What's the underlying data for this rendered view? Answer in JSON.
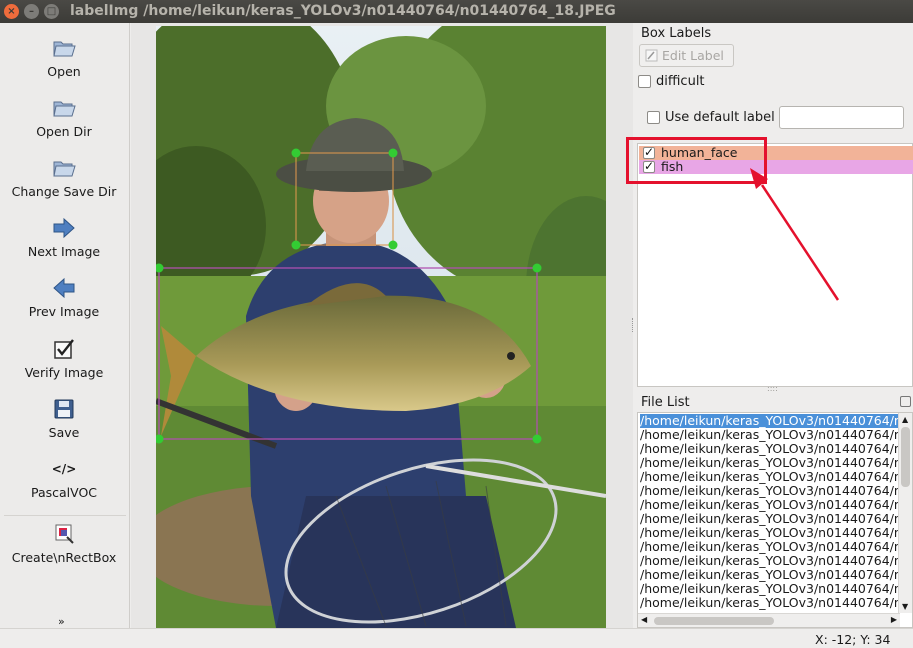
{
  "window": {
    "title": "labelImg /home/leikun/keras_YOLOv3/n01440764/n01440764_18.JPEG",
    "close_glyph": "×",
    "min_glyph": "–",
    "max_glyph": "□"
  },
  "toolbar": {
    "items": [
      {
        "label": "Open",
        "icon": "folder-open-icon"
      },
      {
        "label": "Open Dir",
        "icon": "folder-open-icon"
      },
      {
        "label": "Change Save Dir",
        "icon": "folder-open-icon"
      },
      {
        "label": "Next Image",
        "icon": "arrow-right-icon"
      },
      {
        "label": "Prev Image",
        "icon": "arrow-left-icon"
      },
      {
        "label": "Verify Image",
        "icon": "checkbox-icon"
      },
      {
        "label": "Save",
        "icon": "floppy-disk-icon"
      },
      {
        "label": "PascalVOC",
        "icon": "code-tag-icon",
        "glyph": "</>"
      },
      {
        "label": "Create\\nRectBox",
        "icon": "draw-rect-icon"
      }
    ],
    "more_glyph": "»"
  },
  "canvas": {
    "boxes": [
      {
        "label": "human_face",
        "color": "#e8a26a"
      },
      {
        "label": "fish",
        "color": "#c060c0"
      }
    ]
  },
  "box_labels_panel": {
    "title": "Box Labels",
    "edit_label_button": "Edit Label",
    "difficult_label": "difficult",
    "difficult_checked": false,
    "use_default_label": "Use default label",
    "use_default_checked": false,
    "default_label_value": "",
    "labels": [
      {
        "name": "human_face",
        "checked": true,
        "bg": "#f2b398"
      },
      {
        "name": "fish",
        "checked": true,
        "bg": "#e8a6e6"
      }
    ]
  },
  "file_list_panel": {
    "title": "File List",
    "selected_index": 0,
    "files": [
      "/home/leikun/keras_YOLOv3/n01440764/n0",
      "/home/leikun/keras_YOLOv3/n01440764/n0",
      "/home/leikun/keras_YOLOv3/n01440764/n0",
      "/home/leikun/keras_YOLOv3/n01440764/n0",
      "/home/leikun/keras_YOLOv3/n01440764/n0",
      "/home/leikun/keras_YOLOv3/n01440764/n0",
      "/home/leikun/keras_YOLOv3/n01440764/n0",
      "/home/leikun/keras_YOLOv3/n01440764/n0",
      "/home/leikun/keras_YOLOv3/n01440764/n0",
      "/home/leikun/keras_YOLOv3/n01440764/n0",
      "/home/leikun/keras_YOLOv3/n01440764/n0",
      "/home/leikun/keras_YOLOv3/n01440764/n0",
      "/home/leikun/keras_YOLOv3/n01440764/n0",
      "/home/leikun/keras_YOLOv3/n01440764/n0"
    ]
  },
  "status": {
    "coords": "X: -12; Y: 34"
  }
}
